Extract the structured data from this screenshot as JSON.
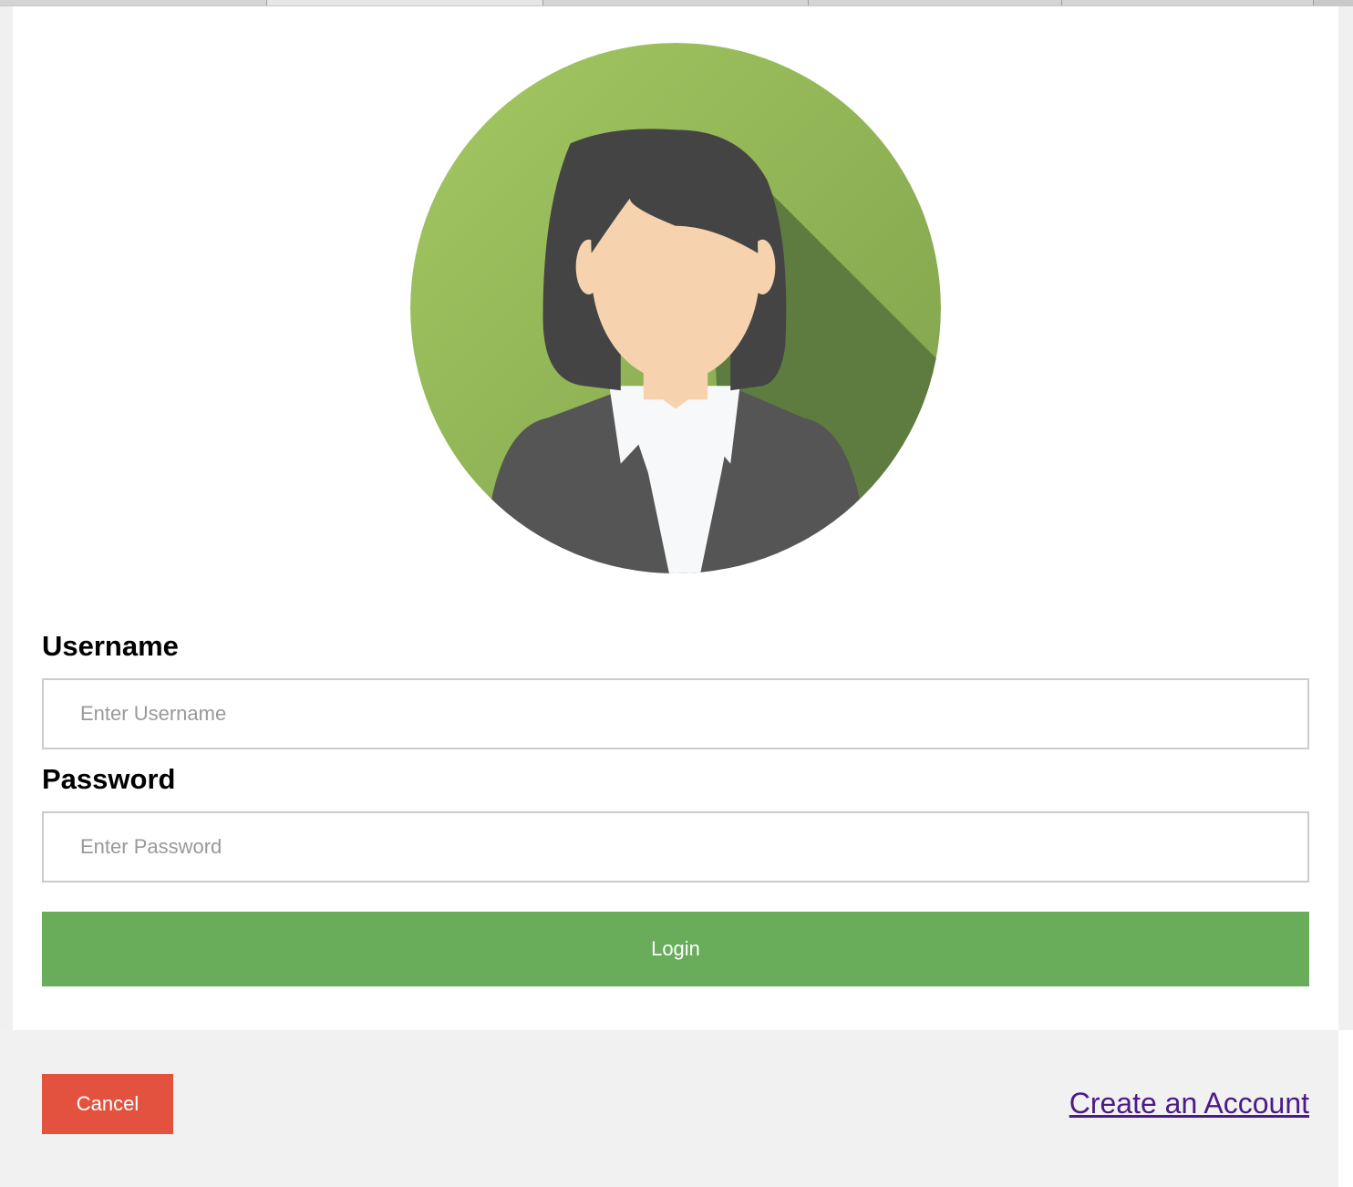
{
  "form": {
    "avatar_alt": "avatar",
    "username_label": "Username",
    "username_placeholder": "Enter Username",
    "password_label": "Password",
    "password_placeholder": "Enter Password",
    "login_label": "Login"
  },
  "footer": {
    "cancel_label": "Cancel",
    "create_account_label": "Create an Account"
  },
  "colors": {
    "login_button": "#69ac5a",
    "cancel_button": "#e3523f",
    "link": "#4b1b86",
    "footer_bg": "#f1f1f1"
  }
}
